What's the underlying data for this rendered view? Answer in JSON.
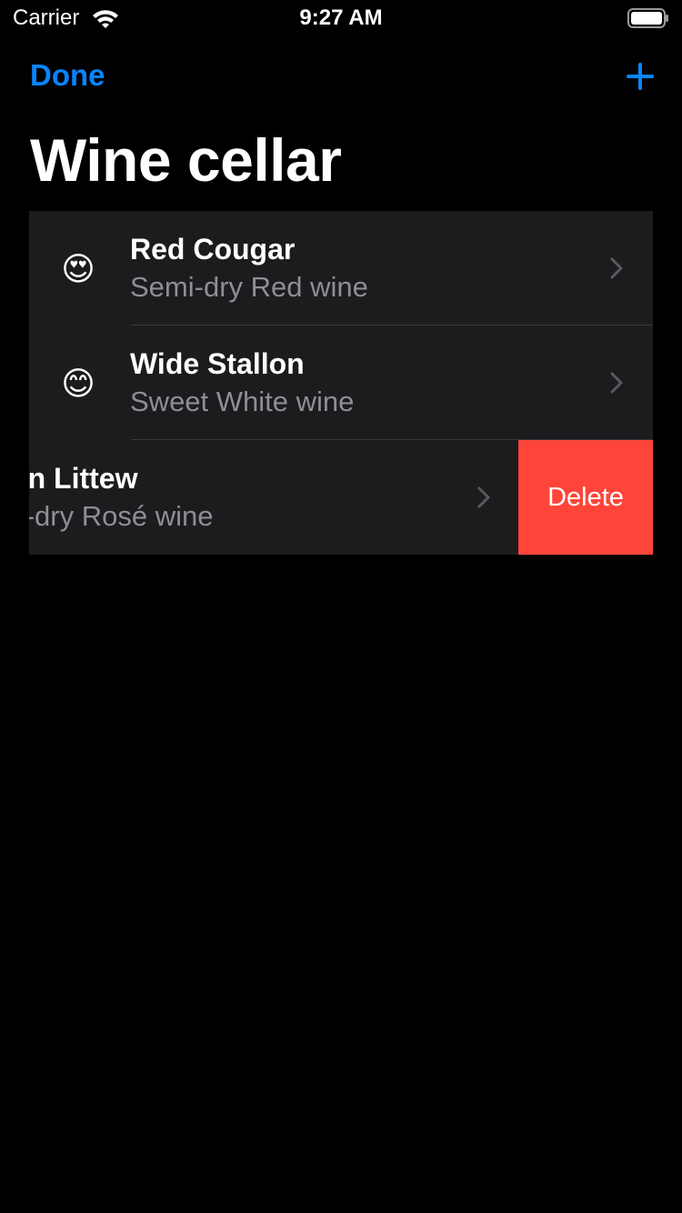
{
  "status_bar": {
    "carrier": "Carrier",
    "time": "9:27 AM",
    "wifi_icon": "wifi-icon",
    "battery_icon": "battery-icon"
  },
  "nav": {
    "done_label": "Done",
    "add_icon": "plus-icon",
    "accent_color": "#0a84ff"
  },
  "title": "Wine cellar",
  "wines": [
    {
      "emoji": "😍",
      "name": "Red Cougar",
      "description": "Semi-dry Red wine"
    },
    {
      "emoji": "😊",
      "name": "Wide Stallon",
      "description": "Sweet White wine"
    },
    {
      "emoji": "",
      "name": "een Littew",
      "description": "mi-dry Rosé wine"
    }
  ],
  "swipe_action": {
    "delete_label": "Delete",
    "color": "#ff453a"
  }
}
